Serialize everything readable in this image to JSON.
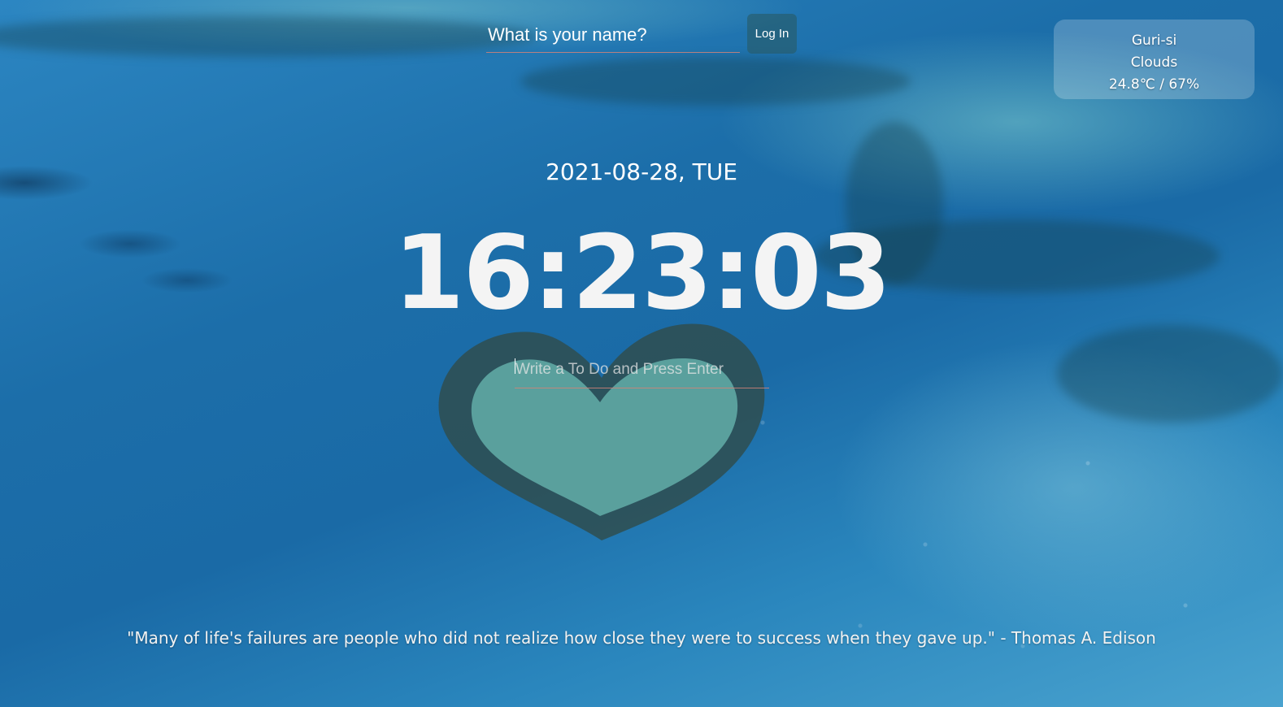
{
  "login": {
    "name_placeholder": "What is your name?",
    "button_label": "Log In"
  },
  "weather": {
    "city": "Guri-si",
    "condition": "Clouds",
    "temp_humidity": "24.8℃ / 67%"
  },
  "clock": {
    "date": "2021-08-28, TUE",
    "time": "16:23:03"
  },
  "todo": {
    "placeholder": "Write a To Do and Press Enter"
  },
  "quote": {
    "text": "\"Many of life's failures are people who did not realize how close they were to success when they gave up.\"",
    "separator": " - ",
    "author": "Thomas A. Edison"
  }
}
